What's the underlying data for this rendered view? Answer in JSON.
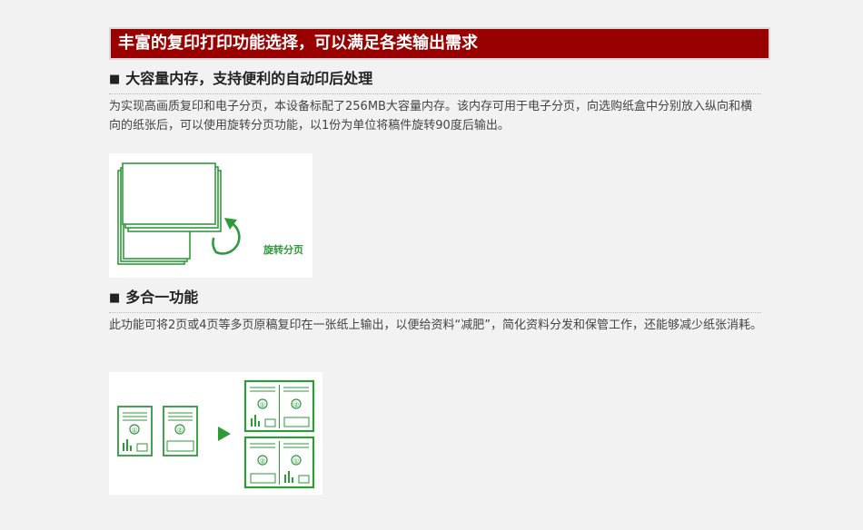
{
  "banner": {
    "title": "丰富的复印打印功能选择，可以满足各类输出需求"
  },
  "sections": [
    {
      "bullet": "■",
      "title": "大容量内存，支持便利的自动印后处理",
      "text": "为实现高画质复印和电子分页，本设备标配了256MB大容量内存。该内存可用于电子分页，向选购纸盒中分别放入纵向和横向的纸张后，可以使用旋转分页功能，以1份为单位将稿件旋转90度后输出。",
      "figure_label": "旋转分页"
    },
    {
      "bullet": "■",
      "title": "多合一功能",
      "text": "此功能可将2页或4页等多页原稿复印在一张纸上输出，以便给资料“减肥”，简化资料分发和保管工作，还能够减少纸张消耗。",
      "figure_numbers": [
        "①",
        "②"
      ]
    }
  ],
  "colors": {
    "banner": "#990000",
    "figure_green": "#2e9a3a"
  }
}
